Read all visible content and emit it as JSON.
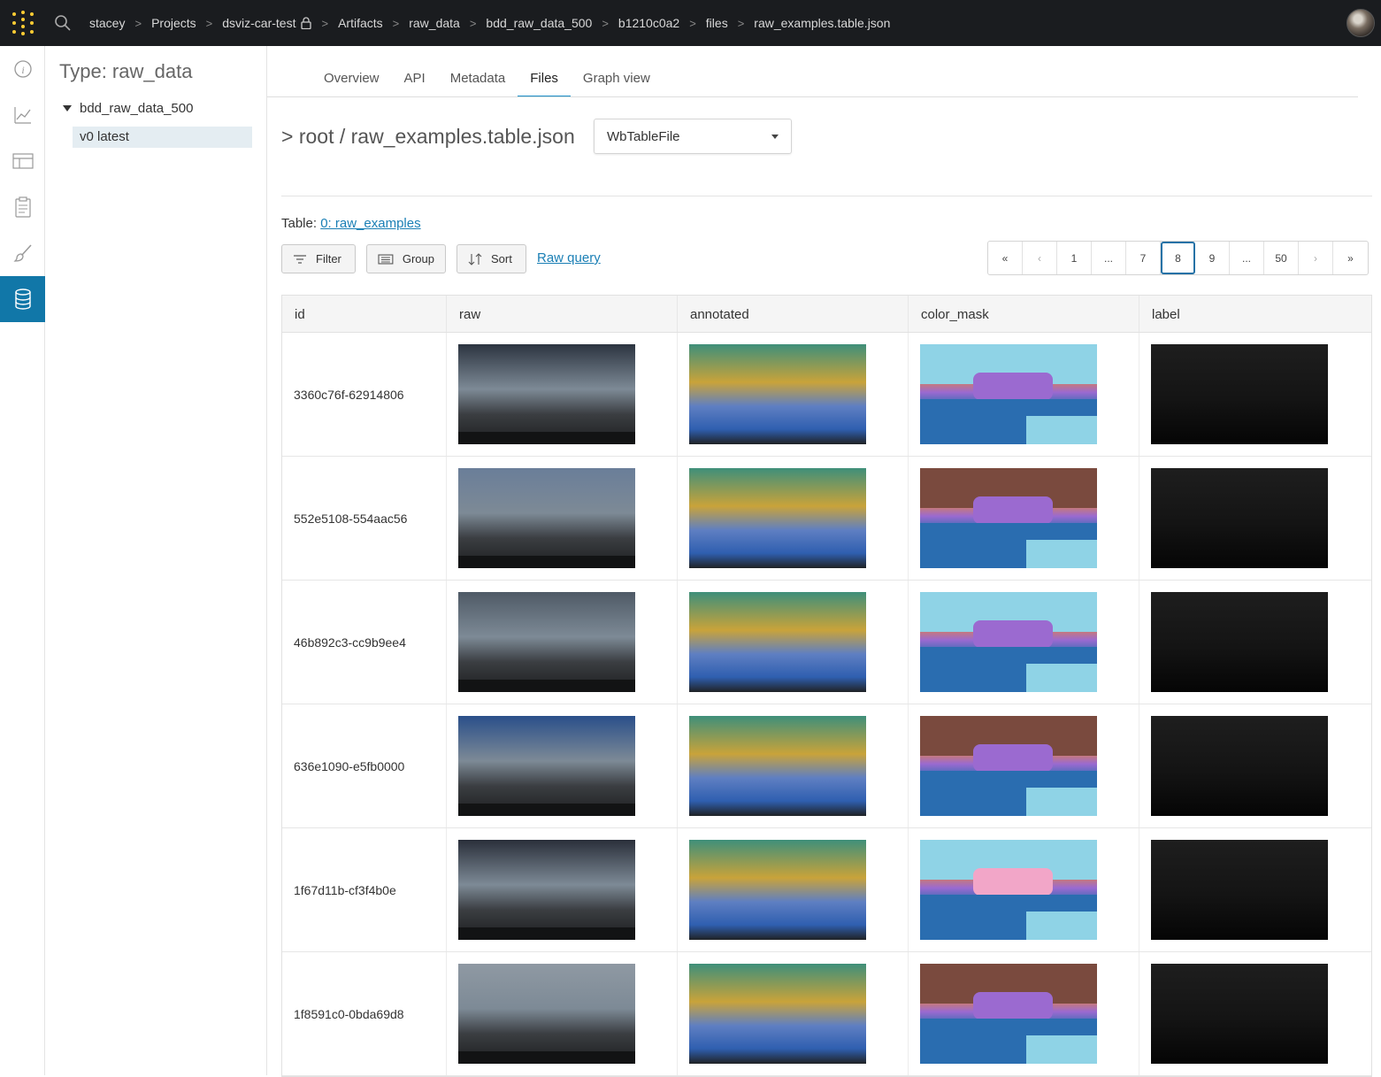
{
  "breadcrumbs": [
    "stacey",
    "Projects",
    "dsviz-car-test",
    "Artifacts",
    "raw_data",
    "bdd_raw_data_500",
    "b1210c0a2",
    "files",
    "raw_examples.table.json"
  ],
  "sidebar": {
    "title": "Type: raw_data",
    "tree_node": "bdd_raw_data_500",
    "version": "v0 latest"
  },
  "rail_icons": [
    "info-icon",
    "chart-icon",
    "table-icon",
    "clipboard-icon",
    "brush-icon",
    "database-icon"
  ],
  "tabs": [
    {
      "label": "Overview"
    },
    {
      "label": "API"
    },
    {
      "label": "Metadata"
    },
    {
      "label": "Files",
      "active": true
    },
    {
      "label": "Graph view"
    }
  ],
  "file_path": "> root / raw_examples.table.json",
  "type_select": {
    "value": "WbTableFile"
  },
  "table_ref": {
    "prefix": "Table:",
    "link": "0: raw_examples"
  },
  "toolbar": {
    "filter": "Filter",
    "group": "Group",
    "sort": "Sort",
    "raw_query": "Raw query"
  },
  "pagination": [
    "«",
    "‹",
    "1",
    "...",
    "7",
    "8",
    "9",
    "...",
    "50",
    "›",
    "»"
  ],
  "pagination_active": "8",
  "table": {
    "columns": [
      "id",
      "raw",
      "annotated",
      "color_mask",
      "label"
    ],
    "rows": [
      {
        "id": "3360c76f-62914806"
      },
      {
        "id": "552e5108-554aac56"
      },
      {
        "id": "46b892c3-cc9b9ee4"
      },
      {
        "id": "636e1090-e5fb0000"
      },
      {
        "id": "1f67d11b-cf3f4b0e"
      },
      {
        "id": "1f8591c0-0bda69d8"
      }
    ]
  },
  "colors": {
    "topbar": "#1a1c1f",
    "accent": "#1177a8",
    "link": "#1a7fb5",
    "logo": "#ffcc33"
  }
}
